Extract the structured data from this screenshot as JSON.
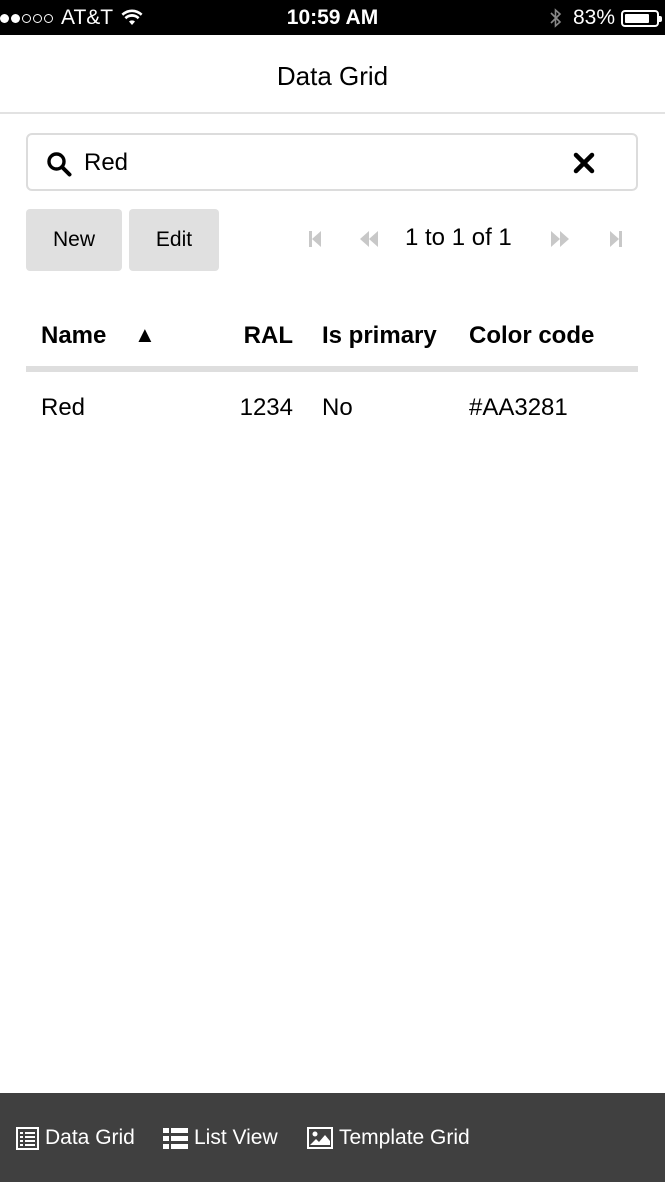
{
  "status_bar": {
    "carrier": "AT&T",
    "time": "10:59 AM",
    "battery_percent": "83%",
    "battery_level": 0.83
  },
  "header": {
    "title": "Data Grid"
  },
  "search": {
    "value": "Red",
    "placeholder": ""
  },
  "toolbar": {
    "new_label": "New",
    "edit_label": "Edit"
  },
  "pager": {
    "text": "1 to 1 of 1"
  },
  "table": {
    "columns": [
      "Name",
      "RAL",
      "Is primary",
      "Color code"
    ],
    "sort_indicator": "▲",
    "rows": [
      {
        "name": "Red",
        "ral": "1234",
        "is_primary": "No",
        "color_code": "#AA3281"
      }
    ]
  },
  "bottom_nav": {
    "items": [
      {
        "label": "Data Grid",
        "icon": "table-icon"
      },
      {
        "label": "List View",
        "icon": "list-icon"
      },
      {
        "label": "Template Grid",
        "icon": "image-icon"
      }
    ]
  },
  "colors": {
    "status_bar_bg": "#000000",
    "bottom_bar_bg": "#404040",
    "button_bg": "#e0e0e0",
    "pager_disabled": "#c8c8c8"
  }
}
